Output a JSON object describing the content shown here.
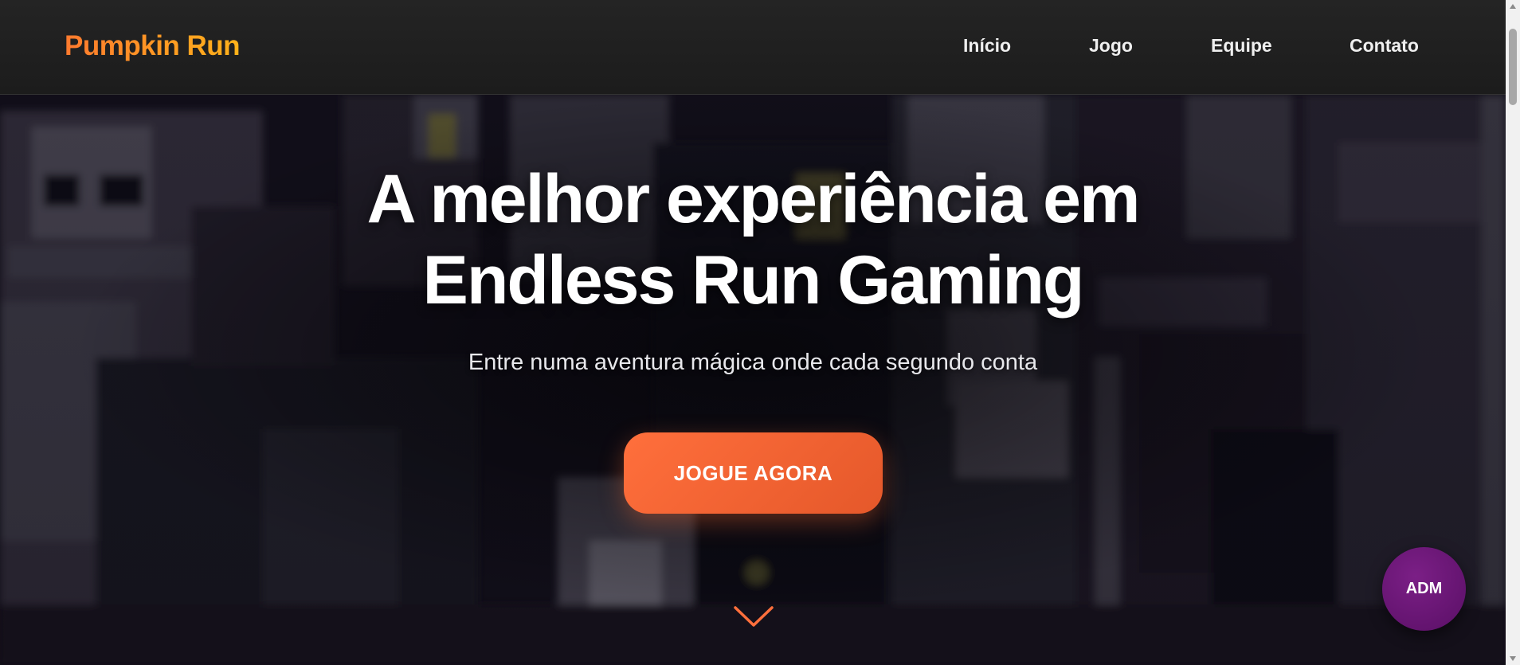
{
  "header": {
    "logo": "Pumpkin Run",
    "nav": [
      "Início",
      "Jogo",
      "Equipe",
      "Contato"
    ]
  },
  "hero": {
    "title_line1": "A melhor experiência em",
    "title_line2": "Endless Run Gaming",
    "subtitle": "Entre numa aventura mágica onde cada segundo conta",
    "cta_label": "JOGUE AGORA",
    "scroll_icon": "chevron-down-icon"
  },
  "fab": {
    "label": "ADM"
  },
  "colors": {
    "logo_gradient_start": "#ff7a2e",
    "logo_gradient_end": "#ffb21a",
    "cta": "#ff6f3c",
    "adm": "#6a1576",
    "header_bg": "#1f1f1f"
  }
}
